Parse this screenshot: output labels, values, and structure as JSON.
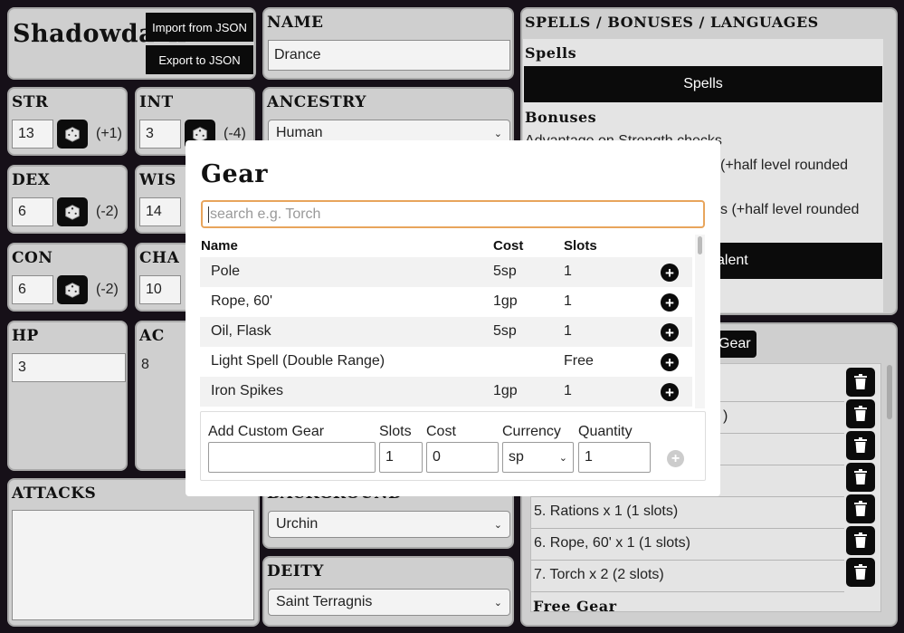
{
  "app": {
    "brand": "Shadowdark",
    "import_label": "Import from JSON",
    "export_label": "Export to JSON"
  },
  "stats": [
    {
      "label": "STR",
      "value": "13",
      "mod": "(+1)"
    },
    {
      "label": "INT",
      "value": "3",
      "mod": "(-4)"
    },
    {
      "label": "DEX",
      "value": "6",
      "mod": "(-2)"
    },
    {
      "label": "WIS",
      "value": "14",
      "mod": ""
    },
    {
      "label": "CON",
      "value": "6",
      "mod": "(-2)"
    },
    {
      "label": "CHA",
      "value": "10",
      "mod": ""
    }
  ],
  "hp": {
    "label": "HP",
    "value": "3"
  },
  "ac": {
    "label": "AC",
    "value": "8"
  },
  "attacks": {
    "label": "ATTACKS"
  },
  "name": {
    "label": "NAME",
    "value": "Drance"
  },
  "ancestry": {
    "label": "ANCESTRY",
    "value": "Human"
  },
  "background": {
    "label": "BACKGROUND",
    "value": "Urchin"
  },
  "deity": {
    "label": "DEITY",
    "value": "Saint Terragnis"
  },
  "spells_panel": {
    "title": "SPELLS / BONUSES / LANGUAGES",
    "spells_heading": "Spells",
    "spells_button": "Spells",
    "bonuses_heading": "Bonuses",
    "bonus_1": "Advantage on Strength checks",
    "bonus_2_tail": "(+half level rounded",
    "bonus_3_tail": "s (+half level rounded",
    "talent_button_tail": "alent"
  },
  "gear_panel": {
    "button_tail": "Gear",
    "items_visible": [
      ")",
      "5. Rations x 1 (1 slots)",
      "6. Rope, 60' x 1 (1 slots)",
      "7. Torch x 2 (2 slots)"
    ],
    "free_gear_heading": "Free Gear"
  },
  "modal": {
    "title": "Gear",
    "search_placeholder": "search e.g. Torch",
    "columns": {
      "name": "Name",
      "cost": "Cost",
      "slots": "Slots"
    },
    "rows": [
      {
        "name": "Pole",
        "cost": "5sp",
        "slots": "1"
      },
      {
        "name": "Rope, 60'",
        "cost": "1gp",
        "slots": "1"
      },
      {
        "name": "Oil, Flask",
        "cost": "5sp",
        "slots": "1"
      },
      {
        "name": "Light Spell (Double Range)",
        "cost": "",
        "slots": "Free"
      },
      {
        "name": "Iron Spikes",
        "cost": "1gp",
        "slots": "1"
      }
    ],
    "custom": {
      "name_label": "Add Custom Gear",
      "name_value": "",
      "slots_label": "Slots",
      "slots_value": "1",
      "cost_label": "Cost",
      "cost_value": "0",
      "currency_label": "Currency",
      "currency_value": "sp",
      "quantity_label": "Quantity",
      "quantity_value": "1"
    }
  }
}
